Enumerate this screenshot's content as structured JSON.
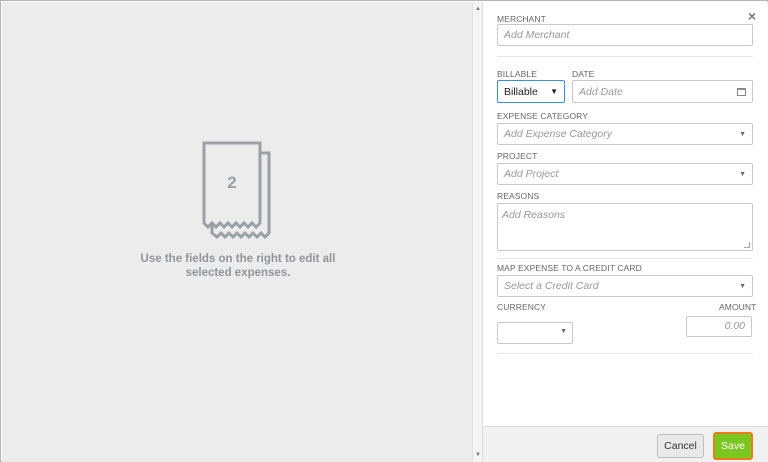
{
  "preview": {
    "selected_count": "2",
    "message_line1": "Use the fields on the right to edit all",
    "message_line2": "selected expenses."
  },
  "form": {
    "close_icon": "×",
    "merchant": {
      "label": "MERCHANT",
      "placeholder": "Add Merchant"
    },
    "billable": {
      "label": "BILLABLE",
      "value": "Billable"
    },
    "date": {
      "label": "DATE",
      "placeholder": "Add Date"
    },
    "category": {
      "label": "EXPENSE CATEGORY",
      "placeholder": "Add Expense Category"
    },
    "project": {
      "label": "PROJECT",
      "placeholder": "Add Project"
    },
    "reasons": {
      "label": "REASONS",
      "placeholder": "Add Reasons"
    },
    "credit_card": {
      "label": "MAP EXPENSE TO A CREDIT CARD",
      "placeholder": "Select a Credit Card"
    },
    "currency": {
      "label": "CURRENCY",
      "value": ""
    },
    "amount": {
      "label": "AMOUNT",
      "placeholder": "0.00"
    }
  },
  "footer": {
    "cancel_label": "Cancel",
    "save_label": "Save"
  },
  "colors": {
    "save_bg": "#7cc621",
    "save_border": "#ee7d18",
    "billable_border": "#3b8de0"
  }
}
